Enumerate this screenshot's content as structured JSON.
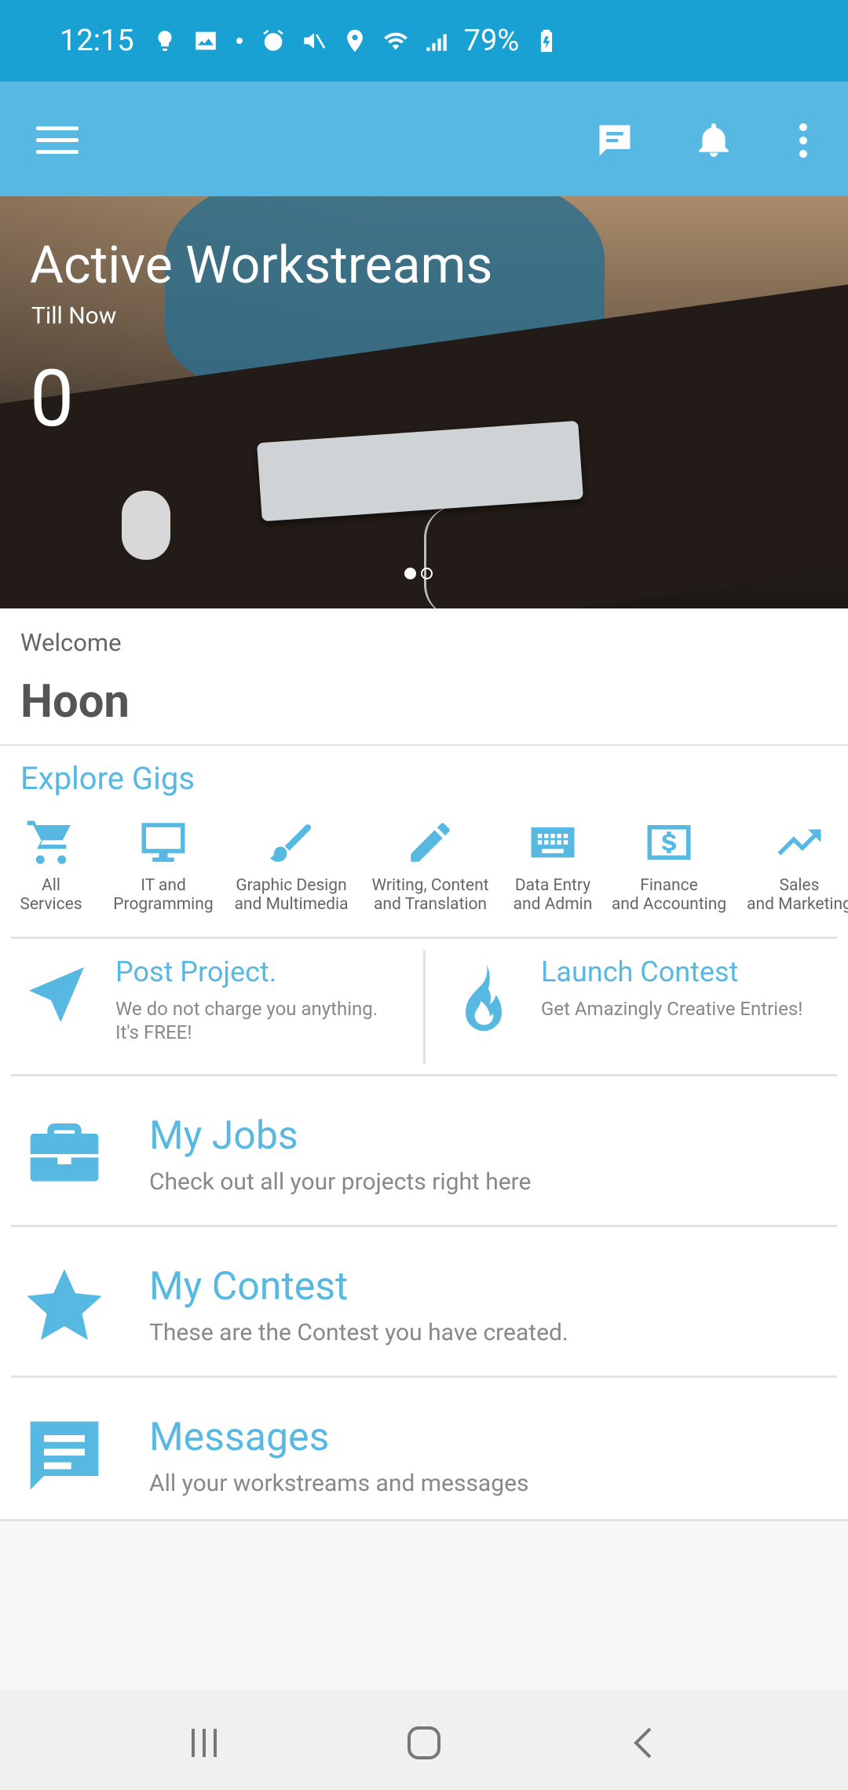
{
  "status_bar": {
    "time": "12:15",
    "battery": "79%"
  },
  "hero": {
    "title": "Active Workstreams",
    "subtitle": "Till Now",
    "count": "0",
    "active_slide": 1,
    "slides": 2
  },
  "welcome": {
    "label": "Welcome",
    "name": "Hoon"
  },
  "gigs": {
    "title": "Explore Gigs",
    "categories": [
      {
        "line1": "All",
        "line2": "Services",
        "icon": "cart-icon"
      },
      {
        "line1": "IT and",
        "line2": "Programming",
        "icon": "monitor-icon"
      },
      {
        "line1": "Graphic Design",
        "line2": "and Multimedia",
        "icon": "brush-icon"
      },
      {
        "line1": "Writing, Content",
        "line2": "and Translation",
        "icon": "pencil-icon"
      },
      {
        "line1": "Data Entry",
        "line2": "and Admin",
        "icon": "keyboard-icon"
      },
      {
        "line1": "Finance",
        "line2": "and Accounting",
        "icon": "dollar-icon"
      },
      {
        "line1": "Sales",
        "line2": "and Marketing",
        "icon": "trending-icon"
      }
    ]
  },
  "actions": {
    "post": {
      "title": "Post Project.",
      "desc1": "We do not charge you anything.",
      "desc2": "It's FREE!"
    },
    "contest": {
      "title": "Launch Contest",
      "desc": "Get Amazingly Creative Entries!"
    }
  },
  "rows": {
    "jobs": {
      "title": "My Jobs",
      "desc": "Check out all your projects right here"
    },
    "contest": {
      "title": "My Contest",
      "desc": "These are the Contest you have created."
    },
    "messages": {
      "title": "Messages",
      "desc": " All your workstreams and messages"
    }
  },
  "colors": {
    "accent": "#57b9e2",
    "status_bar": "#1aa1d4"
  }
}
